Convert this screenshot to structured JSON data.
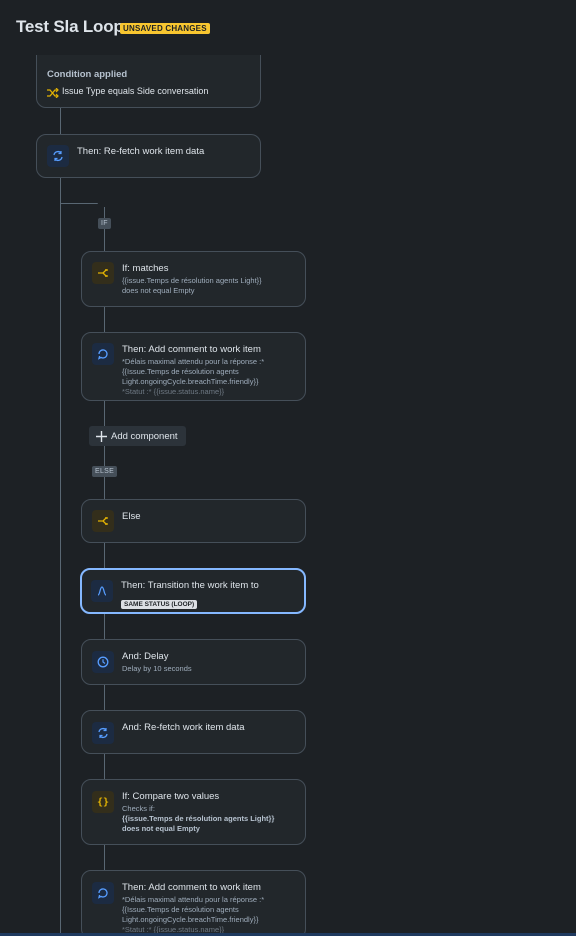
{
  "header": {
    "title": "Test Sla Loop",
    "badge": "UNSAVED CHANGES"
  },
  "tags": {
    "if": "IF",
    "else": "ELSE"
  },
  "add_component": {
    "label": "Add component",
    "icon": "plus-icon"
  },
  "cards": {
    "condition": {
      "title": "Condition applied",
      "text": "Issue Type equals Side conversation",
      "icon": "shuffle-icon"
    },
    "refetch1": {
      "title": "Then: Re-fetch work item data",
      "icon": "refresh-icon"
    },
    "if_matches": {
      "title": "If: matches",
      "line1": "{{issue.Temps de résolution agents Light}}",
      "line2": "does not equal Empty",
      "icon": "branch-icon"
    },
    "comment1": {
      "title": "Then: Add comment to work item",
      "line1": "*Délais maximal attendu pour la réponse :*",
      "line2": "{{Issue.Temps de résolution agents",
      "line3": "Light.ongoingCycle.breachTime.friendly}}",
      "line4": "*Statut :* {{issue.status.name}}",
      "icon": "comment-icon"
    },
    "else": {
      "title": "Else",
      "icon": "branch-icon"
    },
    "transition": {
      "title": "Then: Transition the work item to",
      "status": "SAME STATUS (LOOP)",
      "icon": "transition-icon"
    },
    "delay": {
      "title": "And: Delay",
      "line1": "Delay by 10 seconds",
      "icon": "clock-icon"
    },
    "refetch2": {
      "title": "And: Re-fetch work item data",
      "icon": "refresh-icon"
    },
    "compare": {
      "title": "If: Compare two values",
      "line1": "Checks if:",
      "line2": "{{issue.Temps de résolution agents Light}}",
      "line3": "does not equal Empty",
      "icon": "braces-icon"
    },
    "comment2": {
      "title": "Then: Add comment to work item",
      "line1": "*Délais maximal attendu pour la réponse :*",
      "line2": "{{Issue.Temps de résolution agents",
      "line3": "Light.ongoingCycle.breachTime.friendly}}",
      "line4": "*Statut :* {{issue.status.name}}",
      "icon": "comment-icon"
    }
  },
  "colors": {
    "background": "#1d2125",
    "card": "#22272b",
    "card_border": "#454f59",
    "selected_border": "#85b8ff",
    "badge": "#f8c630",
    "blue_icon": "#579dff",
    "yellow_icon": "#e2b203"
  }
}
